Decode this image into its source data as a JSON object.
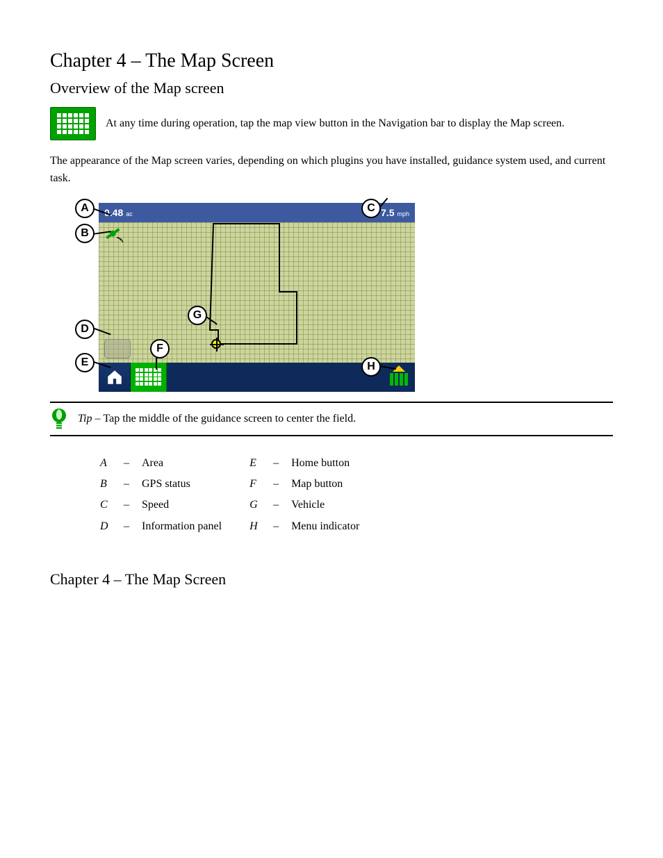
{
  "page_title": "Chapter 4 – The Map Screen",
  "section_title": "Overview of the Map screen",
  "intro_text": "At any time during operation, tap the map view button in the Navigation bar to display the Map screen.",
  "body_para": "The appearance of the Map screen varies, depending on which plugins you have installed, guidance system used, and current task.",
  "topbar_area": "0.48",
  "topbar_area_unit": "ac",
  "topbar_speed": "7.5",
  "topbar_speed_unit": "mph",
  "callouts": [
    "A",
    "B",
    "C",
    "D",
    "E",
    "F",
    "G",
    "H"
  ],
  "tip_label": "Tip – ",
  "tip_text": "Tap the middle of the guidance screen to center the field.",
  "legend": [
    {
      "key": "A",
      "label": "Area"
    },
    {
      "key": "B",
      "label": "GPS status"
    },
    {
      "key": "C",
      "label": "Speed"
    },
    {
      "key": "D",
      "label": "Information panel"
    },
    {
      "key": "E",
      "label": "Home button"
    },
    {
      "key": "F",
      "label": "Map button"
    },
    {
      "key": "G",
      "label": "Vehicle"
    },
    {
      "key": "H",
      "label": "Menu indicator"
    }
  ],
  "chapter_footer": "Chapter 4 – The Map Screen"
}
